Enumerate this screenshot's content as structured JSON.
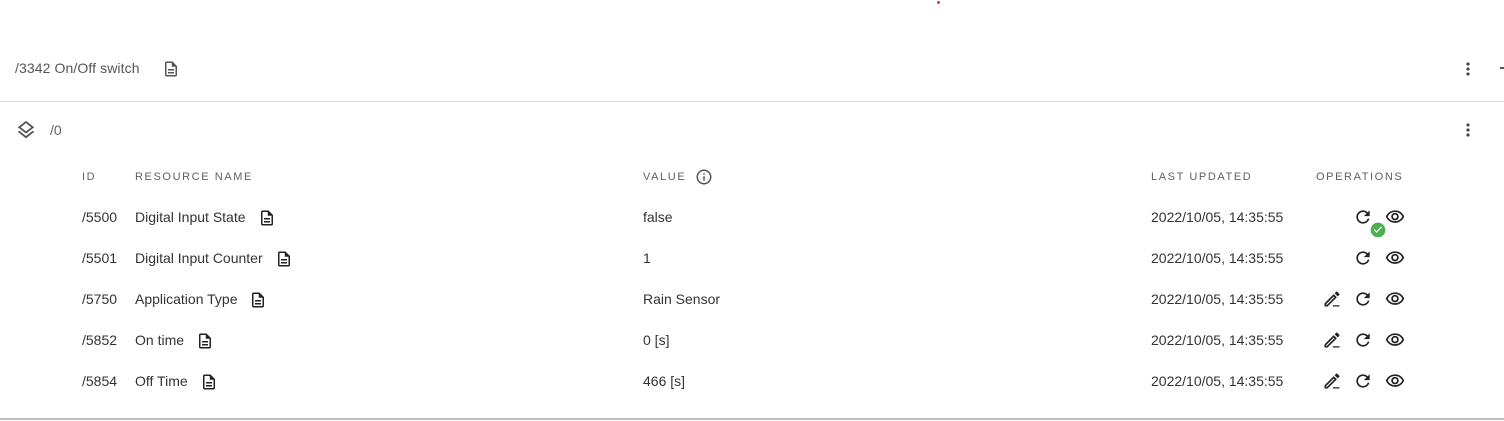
{
  "object": {
    "title": "/3342 On/Off switch"
  },
  "instance": {
    "label": "/0"
  },
  "table": {
    "headers": {
      "id": "ID",
      "resource_name": "RESOURCE NAME",
      "value": "VALUE",
      "last_updated": "LAST UPDATED",
      "operations": "OPERATIONS"
    },
    "rows": [
      {
        "id": "/5500",
        "name": "Digital Input State",
        "value": "false",
        "updated": "2022/10/05, 14:35:55"
      },
      {
        "id": "/5501",
        "name": "Digital Input Counter",
        "value": "1",
        "updated": "2022/10/05, 14:35:55"
      },
      {
        "id": "/5750",
        "name": "Application Type",
        "value": "Rain Sensor",
        "updated": "2022/10/05, 14:35:55"
      },
      {
        "id": "/5852",
        "name": "On time",
        "value": "0 [s]",
        "updated": "2022/10/05, 14:35:55"
      },
      {
        "id": "/5854",
        "name": "Off Time",
        "value": "466 [s]",
        "updated": "2022/10/05, 14:35:55"
      }
    ]
  },
  "icons": {
    "doc": "description-icon",
    "layers": "layers-icon",
    "info": "info-icon",
    "kebab": "more-vertical-icon",
    "refresh": "refresh-icon",
    "view": "eye-icon",
    "edit": "edit-icon",
    "success": "check-circle-icon"
  },
  "colors": {
    "success": "#4caf50",
    "accent_dot": "#e53935",
    "text": "#333333",
    "muted": "#5f5f5f"
  }
}
